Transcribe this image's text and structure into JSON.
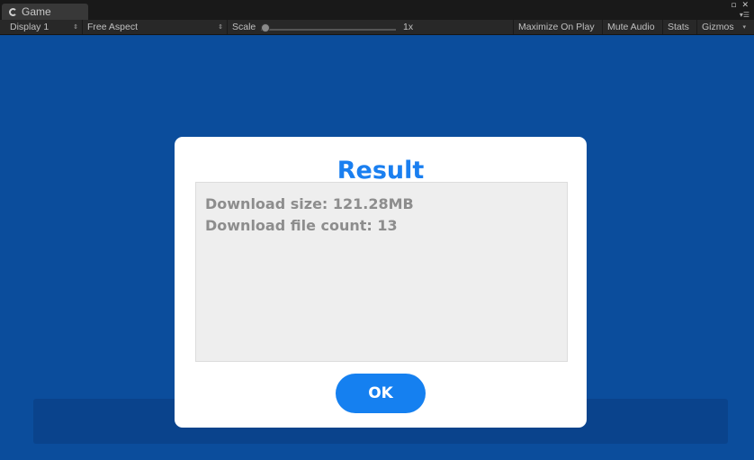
{
  "tab": {
    "title": "Game",
    "icon": "unity-game-icon"
  },
  "window_controls": {
    "maximize": "▫",
    "close": "✕",
    "menu": "▾☰"
  },
  "toolbar": {
    "display": {
      "label": "Display 1",
      "arrow": "⇕"
    },
    "aspect": {
      "label": "Free Aspect",
      "arrow": "⇕"
    },
    "scale": {
      "label": "Scale",
      "value_label": "1x",
      "value": 1
    },
    "maximize_on_play": "Maximize On Play",
    "mute_audio": "Mute Audio",
    "stats": "Stats",
    "gizmos": {
      "label": "Gizmos",
      "arrow": "▾"
    }
  },
  "dialog": {
    "title": "Result",
    "lines": [
      "Download size: 121.28MB",
      "Download file count: 13"
    ],
    "ok_label": "OK"
  },
  "colors": {
    "game_background": "#0b4d9c",
    "title": "#1a7ff0",
    "ok_button": "#1580f0",
    "result_text": "#8d8d8d"
  }
}
